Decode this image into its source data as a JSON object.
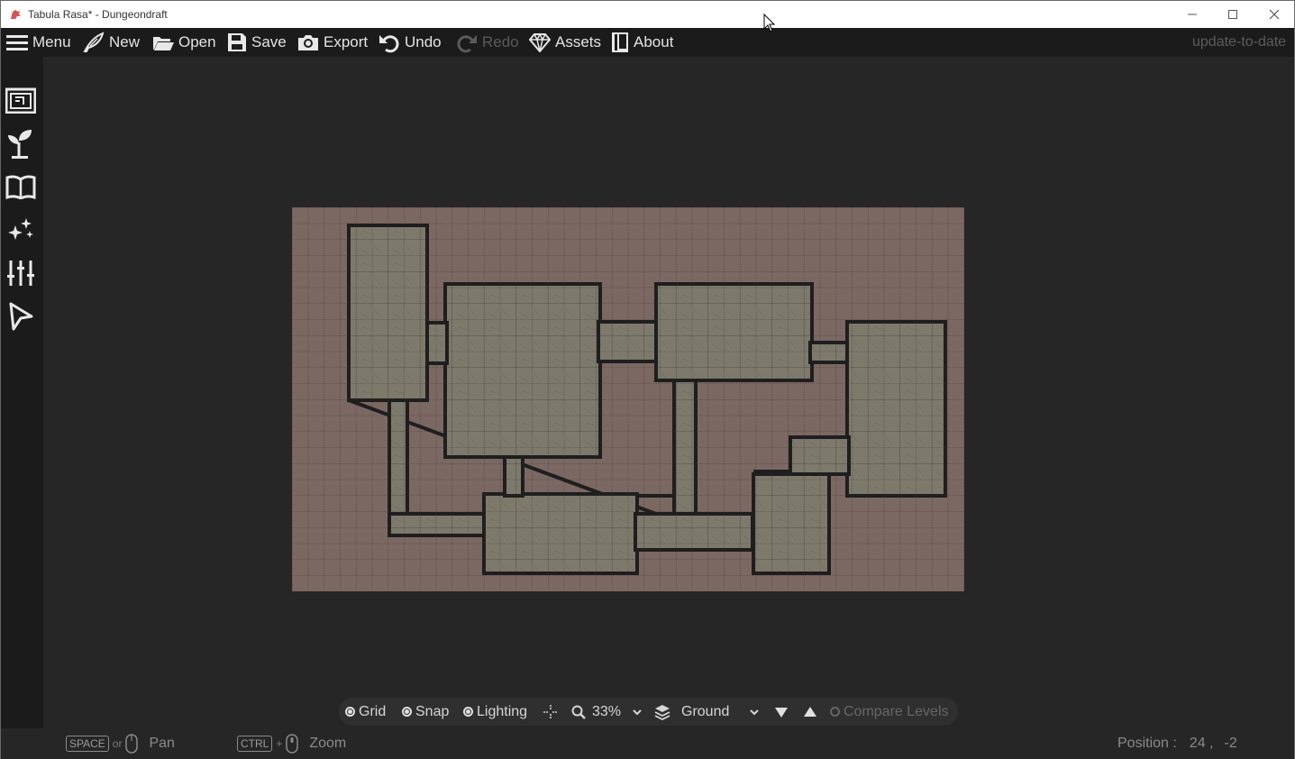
{
  "window": {
    "title": "Tabula Rasa* - Dungeondraft",
    "controls": [
      "minimize",
      "maximize",
      "close"
    ]
  },
  "menubar": {
    "items": [
      {
        "label": "Menu",
        "icon": "hamburger-icon"
      },
      {
        "label": "New",
        "icon": "quill-icon"
      },
      {
        "label": "Open",
        "icon": "folder-open-icon"
      },
      {
        "label": "Save",
        "icon": "floppy-disk-icon"
      },
      {
        "label": "Export",
        "icon": "camera-icon"
      },
      {
        "label": "Undo",
        "icon": "undo-icon"
      },
      {
        "label": "Redo",
        "icon": "redo-icon",
        "disabled": true
      },
      {
        "label": "Assets",
        "icon": "gem-icon"
      },
      {
        "label": "About",
        "icon": "book-icon"
      }
    ],
    "update_status": "update-to-date"
  },
  "sidebar": {
    "tools": [
      {
        "name": "map-settings-icon"
      },
      {
        "name": "plant-icon"
      },
      {
        "name": "open-book-icon"
      },
      {
        "name": "sparkles-icon"
      },
      {
        "name": "sliders-icon"
      },
      {
        "name": "cursor-arrow-icon"
      }
    ]
  },
  "viewbar": {
    "grid_label": "Grid",
    "snap_label": "Snap",
    "lighting_label": "Lighting",
    "zoom_value": "33%",
    "level_value": "Ground",
    "compare_label": "Compare Levels",
    "grid_on": true,
    "snap_on": true,
    "lighting_on": true,
    "compare_on": false
  },
  "statusbar": {
    "pan_key": "SPACE",
    "or_text": "or",
    "pan_label": "Pan",
    "zoom_key": "CTRL",
    "plus_text": "+",
    "zoom_label": "Zoom",
    "position_label": "Position :",
    "position_x": "24 ,",
    "position_y": "-2"
  },
  "colors": {
    "background": "#262626",
    "panel": "#1b1b1b",
    "map_terrain": "#7c6862",
    "map_floor": "#7e7a6c",
    "map_wall": "#222222"
  }
}
